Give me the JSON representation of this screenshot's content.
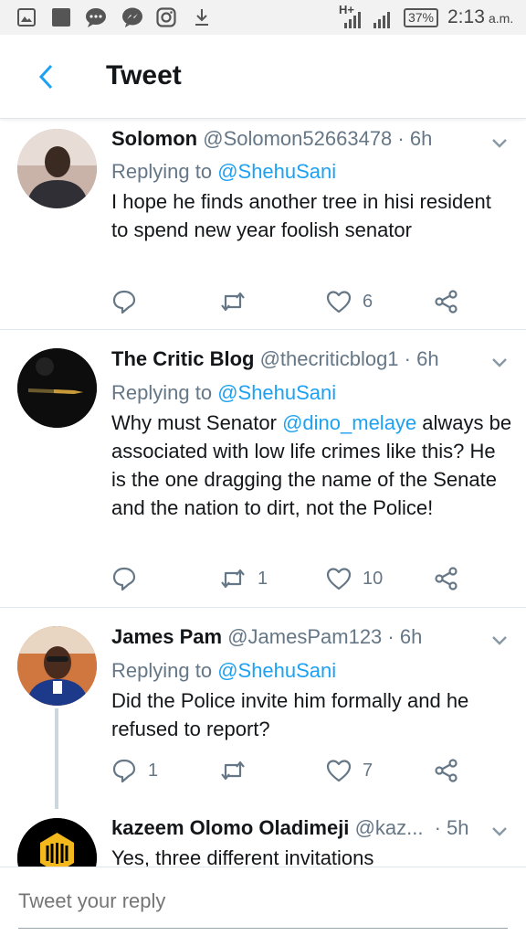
{
  "status_bar": {
    "network": "H+",
    "battery": "37%",
    "time": "2:13",
    "ampm": "a.m."
  },
  "header": {
    "title": "Tweet"
  },
  "tweets": [
    {
      "name": "Solomon",
      "handle": "@Solomon52663478",
      "time": "· 6h",
      "replying_prefix": "Replying to ",
      "replying_to": "@ShehuSani",
      "text": "I hope he finds another tree in hisi resident to spend new year foolish senator",
      "replies": "",
      "retweets": "",
      "likes": "6"
    },
    {
      "name": "The Critic Blog",
      "handle": "@thecriticblog1",
      "time": "· 6h",
      "replying_prefix": "Replying to ",
      "replying_to": "@ShehuSani",
      "text_before": "Why must Senator ",
      "mention": "@dino_melaye",
      "text_after": " always be associated with low life crimes like this? He is the one dragging the name of the Senate and the nation to dirt, not the Police!",
      "replies": "",
      "retweets": "1",
      "likes": "10"
    },
    {
      "name": "James Pam",
      "handle": "@JamesPam123",
      "time": "· 6h",
      "replying_prefix": "Replying to ",
      "replying_to": "@ShehuSani",
      "text": "Did the Police invite him formally and he refused to report?",
      "replies": "1",
      "retweets": "",
      "likes": "7"
    },
    {
      "name": "kazeem Olomo Oladimeji",
      "handle": "@kaz...",
      "time": "· 5h",
      "text": "Yes, three different invitations"
    }
  ],
  "reply_bar": {
    "placeholder": "Tweet your reply"
  },
  "colors": {
    "accent": "#1da1f2",
    "secondary_text": "#657786",
    "divider": "#e1e8ed"
  }
}
